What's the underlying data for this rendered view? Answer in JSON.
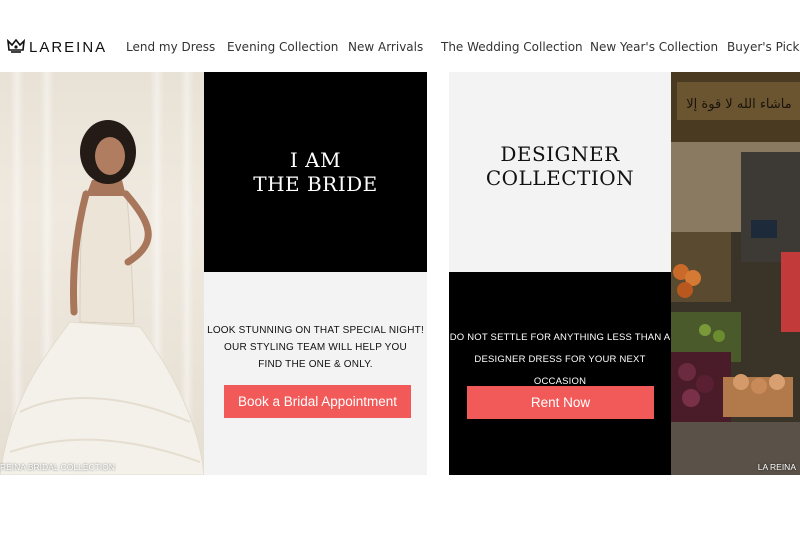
{
  "brand": {
    "name": "LAREINA"
  },
  "nav": {
    "items": [
      "Lend my Dress",
      "Evening Collection",
      "New Arrivals",
      "The Wedding Collection",
      "New Year's Collection",
      "Buyer's Picks"
    ]
  },
  "bride_panel": {
    "title_line1": "I AM",
    "title_line2": "THE BRIDE",
    "copy_line1": "LOOK STUNNING ON THAT SPECIAL NIGHT!",
    "copy_line2": "OUR STYLING TEAM WILL HELP YOU",
    "copy_line3": "FIND THE ONE & ONLY.",
    "cta_label": "Book a Bridal Appointment"
  },
  "designer_panel": {
    "title_line1": "DESIGNER",
    "title_line2": "COLLECTION",
    "copy_line1": "DO NOT SETTLE FOR ANYTHING LESS THAN A",
    "copy_line2": "DESIGNER DRESS FOR YOUR NEXT OCCASION",
    "cta_label": "Rent Now"
  },
  "photos": {
    "bride_caption": "REINA BRIDAL COLLECTION",
    "market_caption": "LA REINA",
    "market_sign_text": "ماشاء الله لا قوة إلا"
  },
  "colors": {
    "accent": "#f25a5a",
    "black": "#000000",
    "light_panel": "#f3f3f3"
  }
}
